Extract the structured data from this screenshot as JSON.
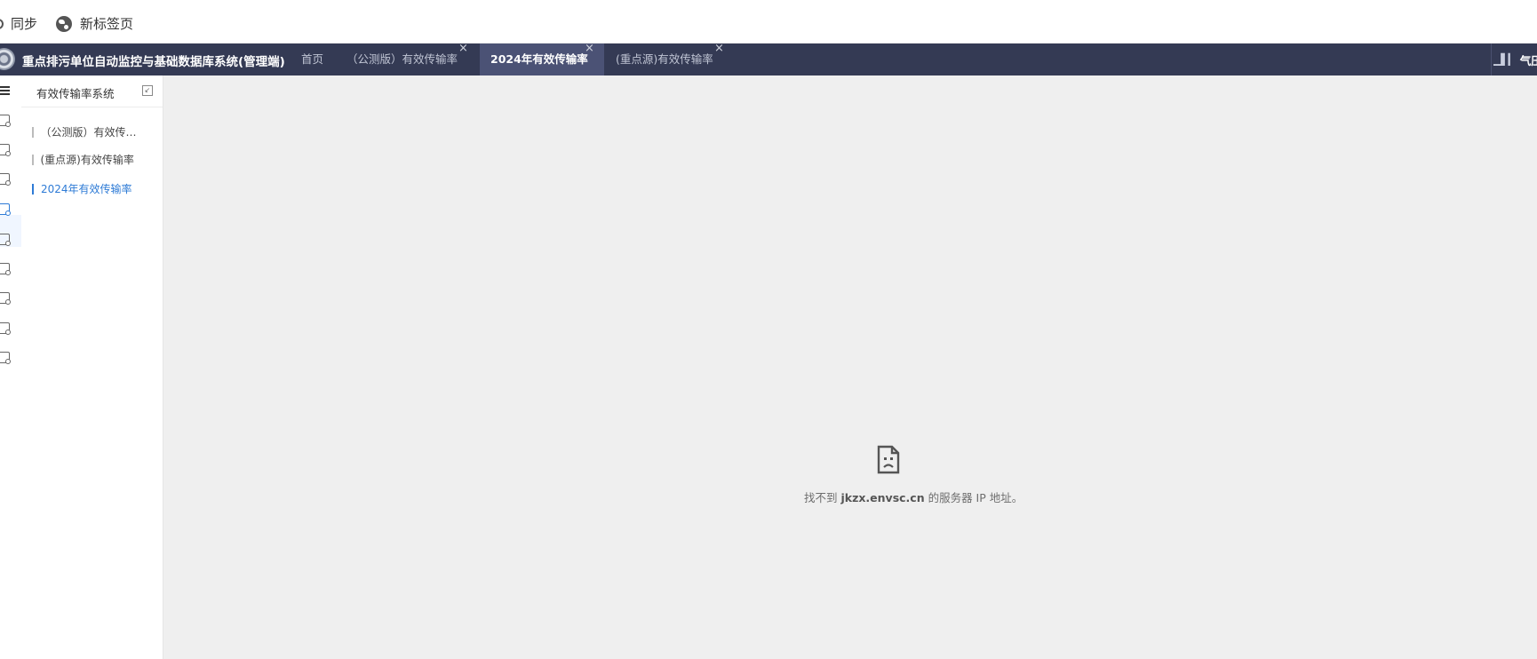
{
  "bookmarks": {
    "items": [
      {
        "label": "同步",
        "icon": "sync-icon"
      },
      {
        "label": "新标签页",
        "icon": "globe-icon"
      }
    ]
  },
  "header": {
    "title": "重点排污单位自动监控与基础数据库系统(管理端)",
    "tabs": [
      {
        "label": "首页",
        "closable": false,
        "active": false
      },
      {
        "label": "（公测版）有效传输率",
        "closable": true,
        "active": false
      },
      {
        "label": "2024年有效传输率",
        "closable": true,
        "active": true
      },
      {
        "label": "(重点源)有效传输率",
        "closable": true,
        "active": false
      }
    ],
    "close_glyph": "×",
    "right_label": "气压蒸",
    "colors": {
      "header_bg": "#343a54",
      "active_tab_bg": "#4b5275",
      "accent": "#2e7bd6"
    }
  },
  "sidebar": {
    "title": "有效传输率系统",
    "collapse_glyph": "↙",
    "items": [
      {
        "label": "（公测版）有效传…",
        "active": false
      },
      {
        "label": "(重点源)有效传输率",
        "active": false
      },
      {
        "label": "2024年有效传输率",
        "active": true
      }
    ]
  },
  "content": {
    "error_prefix": "找不到 ",
    "error_host": "jkzx.envsc.cn",
    "error_suffix": " 的服务器 IP 地址。"
  }
}
